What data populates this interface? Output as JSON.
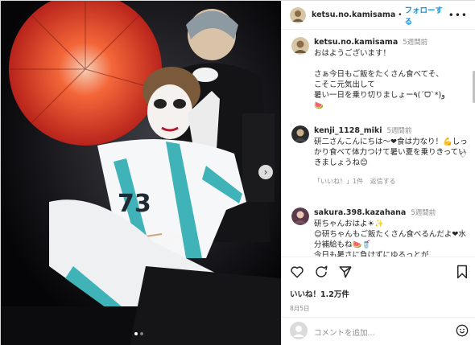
{
  "post": {
    "username": "ketsu.no.kamisama",
    "separator": "•",
    "follow_label": "フォローする",
    "more_label": "•••"
  },
  "caption": {
    "username": "ketsu.no.kamisama",
    "time": "5週間前",
    "text": "おはようございます！\n\nさぁ今日もご飯をたくさん食べてそ、\nこそこ元気出して\n暑い一日を乗り切りましょー٩(ˊᗜˋ*)و\n🍉"
  },
  "comments": [
    {
      "username": "kenji_1128_miki",
      "time": "5週間前",
      "text": "研二さんこんにちは〜❤食は力なり！💪しっかり食べて体力つけて暑い夏を乗りきっていきましょうね😊",
      "likes_label": "「いいね！」1件",
      "reply_label": "返信する"
    },
    {
      "username": "sakura.398.kazahana",
      "time": "5週間前",
      "text": "研ちゃんおはよ☀✨\n😊研ちゃんもご飯たくさん食べるんだよ❤水分補給もね🍉🥤\n今日も暑さに負けずにゆるっとが",
      "likes_label": "",
      "reply_label": ""
    }
  ],
  "likes": "いいね！1.2万件",
  "date": "8月5日",
  "add_comment_placeholder": "コメントを追加...",
  "carousel": {
    "total": 2,
    "current": 1
  },
  "icons": [
    "heart-icon",
    "comment-icon",
    "share-icon",
    "bookmark-icon",
    "emoji-icon",
    "chevron-right-icon",
    "more-icon"
  ],
  "colors": {
    "link": "#0095f6",
    "muted": "#8e8e8e",
    "border": "#dbdbdb"
  }
}
